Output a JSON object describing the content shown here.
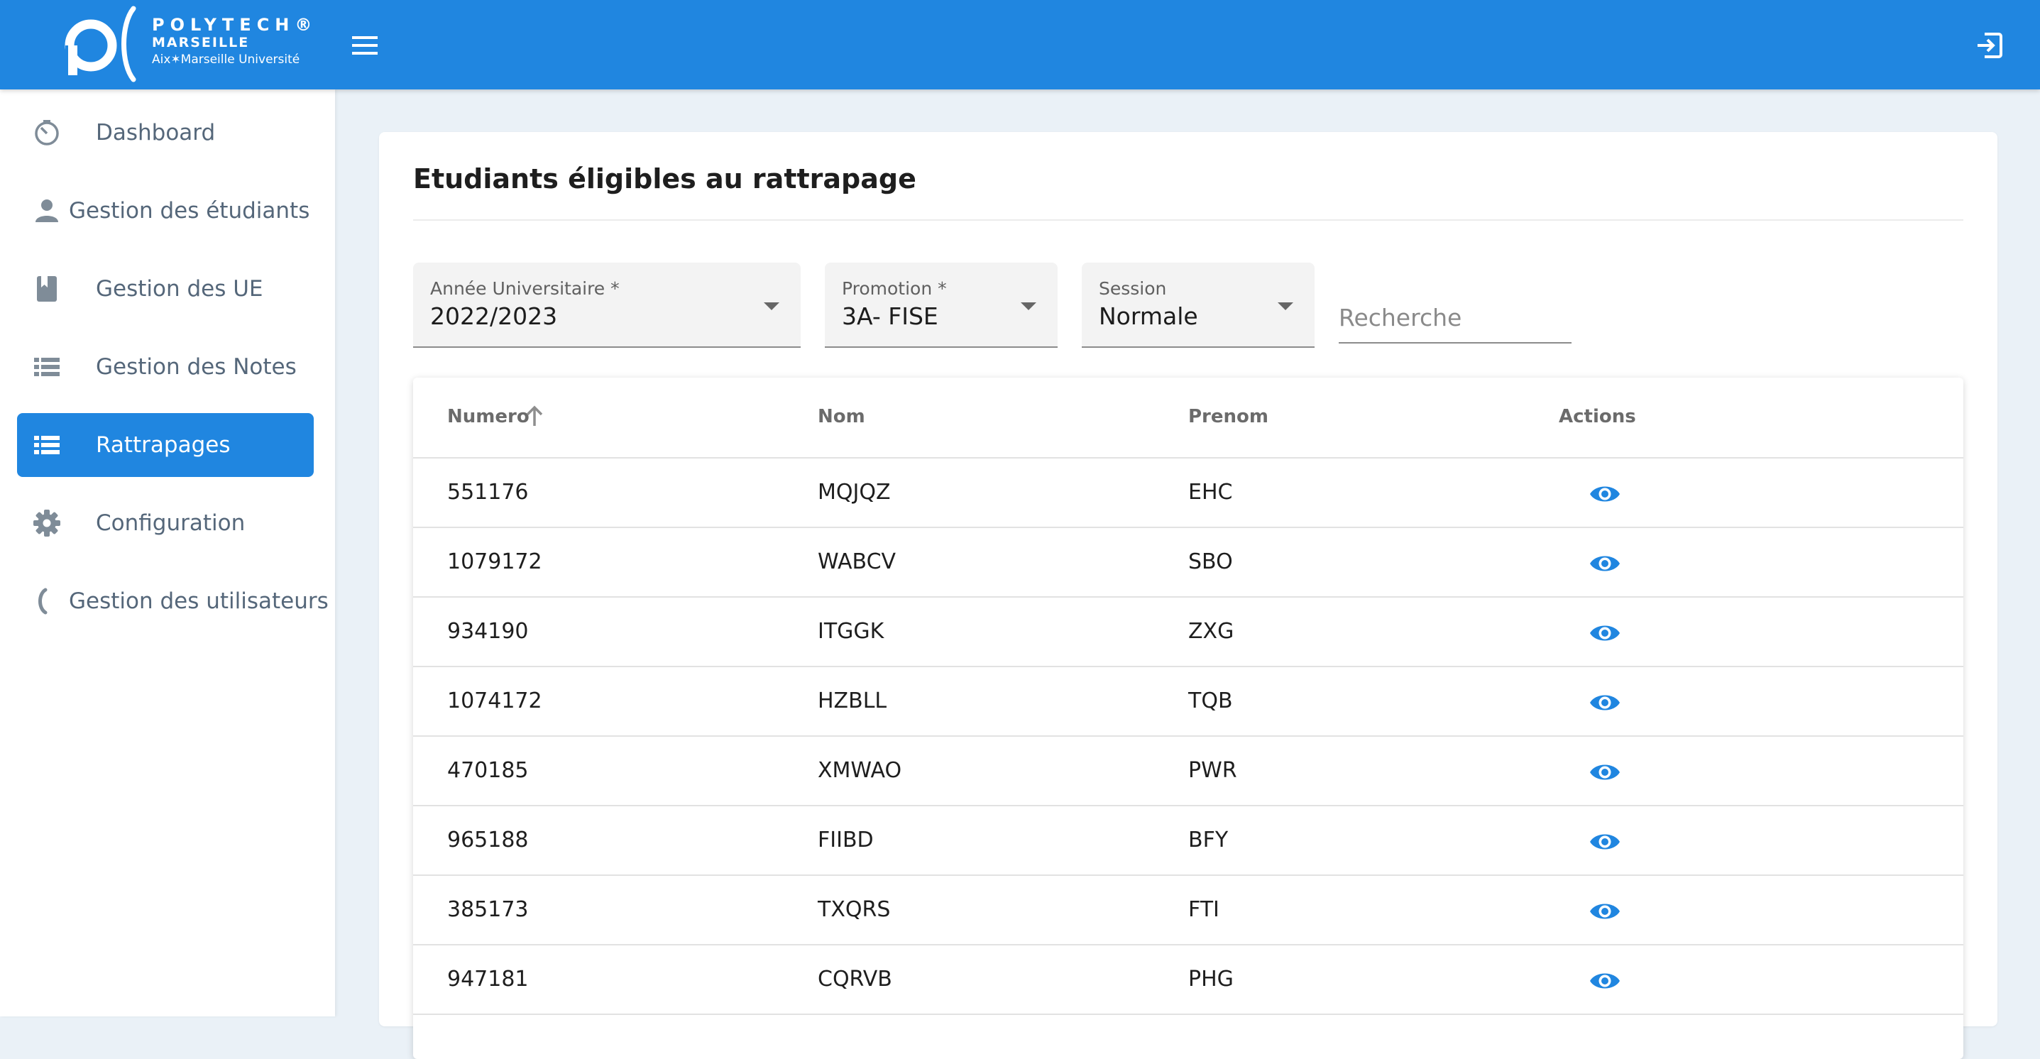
{
  "brand": {
    "line1": "POLYTECH®",
    "line2": "MARSEILLE",
    "line3": "Aix✶Marseille Université",
    "color": "#2086e0"
  },
  "header": {
    "menu_icon": "menu-icon",
    "logout_icon": "logout-icon"
  },
  "sidebar": {
    "items": [
      {
        "label": "Dashboard",
        "icon": "dashboard-timer-icon",
        "active": false
      },
      {
        "label": "Gestion des étudiants",
        "icon": "person-icon",
        "active": false
      },
      {
        "label": "Gestion des UE",
        "icon": "book-icon",
        "active": false
      },
      {
        "label": "Gestion des Notes",
        "icon": "list-icon",
        "active": false
      },
      {
        "label": "Rattrapages",
        "icon": "list-icon",
        "active": true
      },
      {
        "label": "Configuration",
        "icon": "gear-icon",
        "active": false
      },
      {
        "label": "Gestion des utilisateurs",
        "icon": "user-manage-icon",
        "active": false
      }
    ]
  },
  "main": {
    "title": "Etudiants éligibles au rattrapage",
    "filters": {
      "annee": {
        "label": "Année Universitaire *",
        "value": "2022/2023"
      },
      "promotion": {
        "label": "Promotion *",
        "value": "3A- FISE"
      },
      "session": {
        "label": "Session",
        "value": "Normale"
      },
      "search": {
        "placeholder": "Recherche",
        "value": ""
      }
    },
    "table": {
      "columns": [
        "Numero",
        "Nom",
        "Prenom",
        "Actions"
      ],
      "sort": {
        "column": "Numero",
        "direction": "asc"
      },
      "rows": [
        {
          "numero": "551176",
          "nom": "MQJQZ",
          "prenom": "EHC"
        },
        {
          "numero": "1079172",
          "nom": "WABCV",
          "prenom": "SBO"
        },
        {
          "numero": "934190",
          "nom": "ITGGK",
          "prenom": "ZXG"
        },
        {
          "numero": "1074172",
          "nom": "HZBLL",
          "prenom": "TQB"
        },
        {
          "numero": "470185",
          "nom": "XMWAO",
          "prenom": "PWR"
        },
        {
          "numero": "965188",
          "nom": "FIIBD",
          "prenom": "BFY"
        },
        {
          "numero": "385173",
          "nom": "TXQRS",
          "prenom": "FTI"
        },
        {
          "numero": "947181",
          "nom": "CQRVB",
          "prenom": "PHG"
        }
      ],
      "action_icon": "eye-icon",
      "action_color": "#2086e0"
    }
  }
}
